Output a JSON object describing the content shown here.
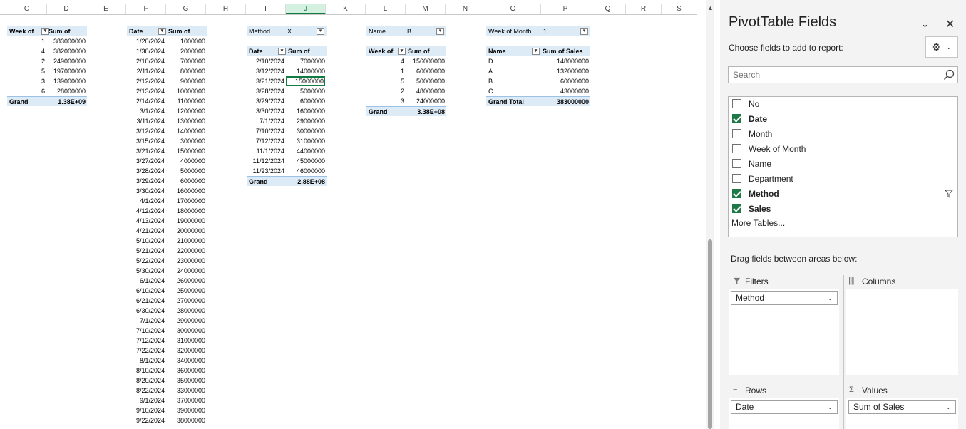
{
  "sheet": {
    "columns": [
      "C",
      "D",
      "E",
      "F",
      "G",
      "H",
      "I",
      "J",
      "K",
      "L",
      "M",
      "N",
      "O",
      "P",
      "Q",
      "R",
      "S"
    ],
    "pivot1": {
      "headers": [
        "Week of",
        "Sum of"
      ],
      "rows": [
        [
          "1",
          "383000000"
        ],
        [
          "4",
          "382000000"
        ],
        [
          "2",
          "249000000"
        ],
        [
          "5",
          "197000000"
        ],
        [
          "3",
          "139000000"
        ],
        [
          "6",
          "28000000"
        ]
      ],
      "total": [
        "Grand",
        "1.38E+09"
      ]
    },
    "pivot2": {
      "headers": [
        "Date",
        "Sum of"
      ],
      "rows": [
        [
          "1/20/2024",
          "1000000"
        ],
        [
          "1/30/2024",
          "2000000"
        ],
        [
          "2/10/2024",
          "7000000"
        ],
        [
          "2/11/2024",
          "8000000"
        ],
        [
          "2/12/2024",
          "9000000"
        ],
        [
          "2/13/2024",
          "10000000"
        ],
        [
          "2/14/2024",
          "11000000"
        ],
        [
          "3/1/2024",
          "12000000"
        ],
        [
          "3/11/2024",
          "13000000"
        ],
        [
          "3/12/2024",
          "14000000"
        ],
        [
          "3/15/2024",
          "3000000"
        ],
        [
          "3/21/2024",
          "15000000"
        ],
        [
          "3/27/2024",
          "4000000"
        ],
        [
          "3/28/2024",
          "5000000"
        ],
        [
          "3/29/2024",
          "6000000"
        ],
        [
          "3/30/2024",
          "16000000"
        ],
        [
          "4/1/2024",
          "17000000"
        ],
        [
          "4/12/2024",
          "18000000"
        ],
        [
          "4/13/2024",
          "19000000"
        ],
        [
          "4/21/2024",
          "20000000"
        ],
        [
          "5/10/2024",
          "21000000"
        ],
        [
          "5/21/2024",
          "22000000"
        ],
        [
          "5/22/2024",
          "23000000"
        ],
        [
          "5/30/2024",
          "24000000"
        ],
        [
          "6/1/2024",
          "26000000"
        ],
        [
          "6/10/2024",
          "25000000"
        ],
        [
          "6/21/2024",
          "27000000"
        ],
        [
          "6/30/2024",
          "28000000"
        ],
        [
          "7/1/2024",
          "29000000"
        ],
        [
          "7/10/2024",
          "30000000"
        ],
        [
          "7/12/2024",
          "31000000"
        ],
        [
          "7/22/2024",
          "32000000"
        ],
        [
          "8/1/2024",
          "34000000"
        ],
        [
          "8/10/2024",
          "36000000"
        ],
        [
          "8/20/2024",
          "35000000"
        ],
        [
          "8/22/2024",
          "33000000"
        ],
        [
          "9/1/2024",
          "37000000"
        ],
        [
          "9/10/2024",
          "39000000"
        ],
        [
          "9/22/2024",
          "38000000"
        ]
      ]
    },
    "pivot3": {
      "filter": [
        "Method",
        "X"
      ],
      "headers": [
        "Date",
        "Sum of"
      ],
      "rows": [
        [
          "2/10/2024",
          "7000000"
        ],
        [
          "3/12/2024",
          "14000000"
        ],
        [
          "3/21/2024",
          "15000000"
        ],
        [
          "3/28/2024",
          "5000000"
        ],
        [
          "3/29/2024",
          "6000000"
        ],
        [
          "3/30/2024",
          "16000000"
        ],
        [
          "7/1/2024",
          "29000000"
        ],
        [
          "7/10/2024",
          "30000000"
        ],
        [
          "7/12/2024",
          "31000000"
        ],
        [
          "11/1/2024",
          "44000000"
        ],
        [
          "11/12/2024",
          "45000000"
        ],
        [
          "11/23/2024",
          "46000000"
        ]
      ],
      "total": [
        "Grand",
        "2.88E+08"
      ]
    },
    "pivot4": {
      "filter": [
        "Name",
        "B"
      ],
      "headers": [
        "Week of",
        "Sum of"
      ],
      "rows": [
        [
          "4",
          "156000000"
        ],
        [
          "1",
          "60000000"
        ],
        [
          "5",
          "50000000"
        ],
        [
          "2",
          "48000000"
        ],
        [
          "3",
          "24000000"
        ]
      ],
      "total": [
        "Grand",
        "3.38E+08"
      ]
    },
    "pivot5": {
      "filter": [
        "Week of Month",
        "1"
      ],
      "headers": [
        "Name",
        "Sum of Sales"
      ],
      "rows": [
        [
          "D",
          "148000000"
        ],
        [
          "A",
          "132000000"
        ],
        [
          "B",
          "60000000"
        ],
        [
          "C",
          "43000000"
        ]
      ],
      "total": [
        "Grand Total",
        "383000000"
      ]
    }
  },
  "pane": {
    "title": "PivotTable Fields",
    "choose": "Choose fields to add to report:",
    "search_placeholder": "Search",
    "fields": [
      {
        "label": "No",
        "checked": false,
        "bold": false
      },
      {
        "label": "Date",
        "checked": true,
        "bold": true
      },
      {
        "label": "Month",
        "checked": false,
        "bold": false
      },
      {
        "label": "Week of Month",
        "checked": false,
        "bold": false
      },
      {
        "label": "Name",
        "checked": false,
        "bold": false
      },
      {
        "label": "Department",
        "checked": false,
        "bold": false
      },
      {
        "label": "Method",
        "checked": true,
        "bold": true,
        "filtered": true
      },
      {
        "label": "Sales",
        "checked": true,
        "bold": true
      }
    ],
    "more_tables": "More Tables...",
    "drag_text": "Drag fields between areas below:",
    "areas": {
      "filters": {
        "label": "Filters",
        "item": "Method"
      },
      "columns": {
        "label": "Columns"
      },
      "rows": {
        "label": "Rows",
        "item": "Date"
      },
      "values": {
        "label": "Values",
        "item": "Sum of Sales"
      }
    }
  }
}
